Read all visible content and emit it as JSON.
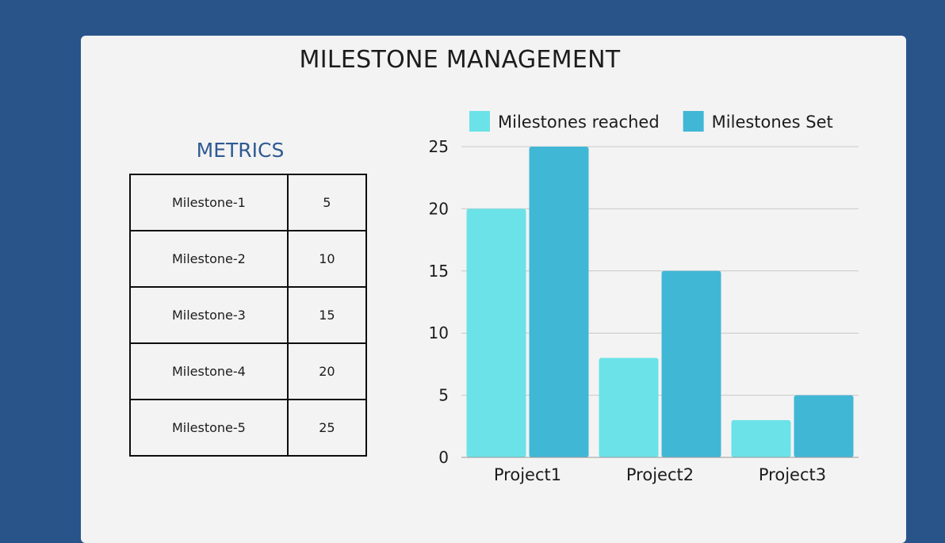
{
  "page": {
    "title": "MILESTONE MANAGEMENT"
  },
  "metrics": {
    "title": "METRICS",
    "rows": [
      {
        "name": "Milestone-1",
        "value": "5"
      },
      {
        "name": "Milestone-2",
        "value": "10"
      },
      {
        "name": "Milestone-3",
        "value": "15"
      },
      {
        "name": "Milestone-4",
        "value": "20"
      },
      {
        "name": "Milestone-5",
        "value": "25"
      }
    ]
  },
  "colors": {
    "background": "#28548a",
    "card": "#f3f3f3",
    "metrics_title": "#2f5a92",
    "series_reached": "#6be2e8",
    "series_set": "#41b7d6",
    "gridline": "#c8c8c8"
  },
  "chart_data": {
    "type": "bar",
    "categories": [
      "Project1",
      "Project2",
      "Project3"
    ],
    "series": [
      {
        "name": "Milestones reached",
        "values": [
          20,
          8,
          3
        ],
        "color": "#6be2e8"
      },
      {
        "name": "Milestones Set",
        "values": [
          25,
          15,
          5
        ],
        "color": "#41b7d6"
      }
    ],
    "yticks": [
      0,
      5,
      10,
      15,
      20,
      25
    ],
    "ylim": [
      0,
      25
    ],
    "grid": true,
    "legend": "top"
  }
}
